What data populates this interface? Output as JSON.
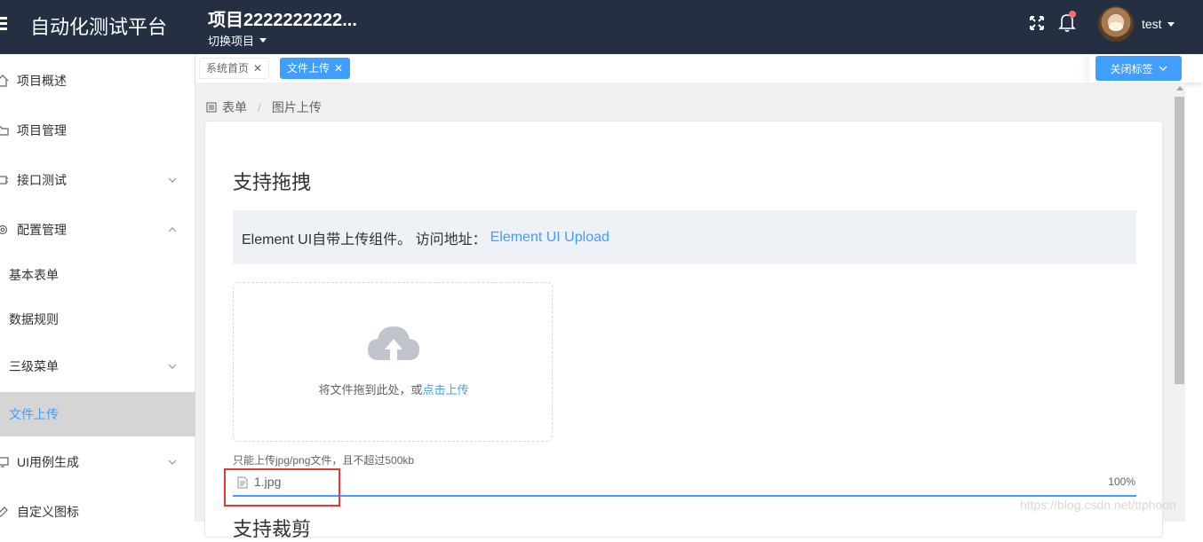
{
  "header": {
    "app_title": "自动化测试平台",
    "project_name": "项目2222222222...",
    "switch_project": "切换项目",
    "username": "test"
  },
  "sidebar": {
    "items": [
      {
        "label": "项目概述",
        "icon": "home-icon"
      },
      {
        "label": "项目管理",
        "icon": "folder-icon"
      },
      {
        "label": "接口测试",
        "icon": "chip-icon",
        "expandable": true
      },
      {
        "label": "配置管理",
        "icon": "gear-icon",
        "expanded": true
      },
      {
        "label": "基本表单"
      },
      {
        "label": "数据规则"
      },
      {
        "label": "三级菜单",
        "expandable": true
      },
      {
        "label": "文件上传",
        "active": true
      },
      {
        "label": "UI用例生成",
        "icon": "monitor-icon",
        "expandable": true
      },
      {
        "label": "自定义图标",
        "icon": "edit-icon"
      }
    ]
  },
  "tags": {
    "items": [
      {
        "label": "系统首页",
        "active": false
      },
      {
        "label": "文件上传",
        "active": true
      }
    ],
    "close_label": "关闭标签"
  },
  "breadcrumb": {
    "section": "表单",
    "page": "图片上传"
  },
  "card": {
    "title": "支持拖拽",
    "tip_text": "Element UI自带上传组件。 访问地址：",
    "tip_link": "Element UI Upload",
    "drag_text": "将文件拖到此处，或",
    "drag_link": "点击上传",
    "upload_tip": "只能上传jpg/png文件，且不超过500kb",
    "file_name": "1.jpg",
    "file_progress_label": "100%",
    "file_progress": 100,
    "next_title": "支持裁剪"
  },
  "watermark": "https://blog.csdn.net/ttphoon",
  "colors": {
    "header_bg": "#242f42",
    "accent": "#409eff",
    "highlight_box": "#e53935"
  }
}
